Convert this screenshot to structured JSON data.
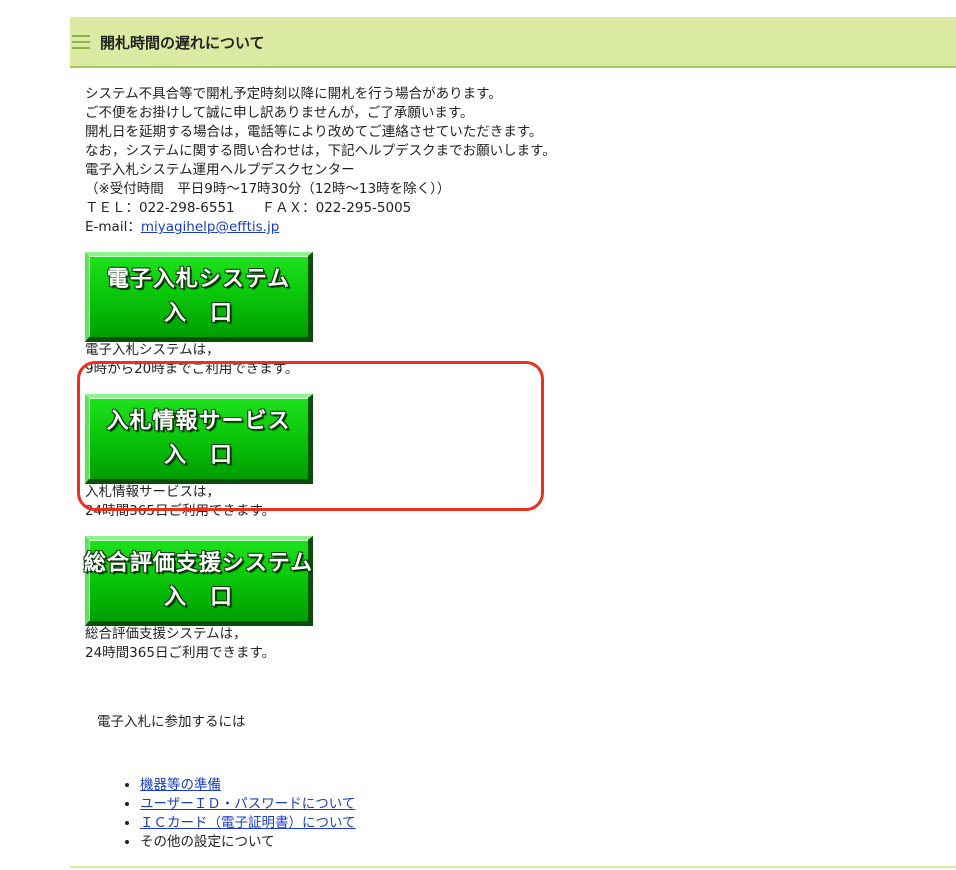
{
  "header": {
    "title": "開札時間の遅れについて"
  },
  "notice": {
    "lines": [
      "システム不具合等で開札予定時刻以降に開札を行う場合があります。",
      "ご不便をお掛けして誠に申し訳ありませんが，ご了承願います。",
      "開札日を延期する場合は，電話等により改めてご連絡させていただきます。",
      "なお，システムに関する問い合わせは，下記ヘルプデスクまでお願いします。",
      "電子入札システム運用ヘルプデスクセンター",
      "（※受付時間　平日9時〜17時30分（12時〜13時を除く））",
      "ＴＥＬ：022-298-6551　　ＦＡＸ：022-295-5005"
    ],
    "email_label": "E-mail：",
    "email_link": "miyagihelp@efftis.jp"
  },
  "systems": [
    {
      "button_line1": "電子入札システム",
      "button_line2": "入　口",
      "caption_line1": "電子入札システムは，",
      "caption_line2": "9時から20時までご利用できます。"
    },
    {
      "button_line1": "入札情報サービス",
      "button_line2": "入　口",
      "caption_line1": "入札情報サービスは，",
      "caption_line2": "24時間365日ご利用できます。"
    },
    {
      "button_line1": "総合評価支援システム",
      "button_line2": "入　口",
      "caption_line1": "総合評価支援システムは，",
      "caption_line2": "24時間365日ご利用できます。"
    }
  ],
  "join_heading": "電子入札に参加するには",
  "links": [
    "機器等の準備",
    "ユーザーＩＤ・パスワードについて",
    "ＩＣカード（電子証明書）について",
    "その他の設定について"
  ],
  "colors": {
    "header_bg": "#dbeaa3",
    "button_green": "#0ac80a",
    "highlight": "#e8321e",
    "link": "#1a3ec6"
  }
}
